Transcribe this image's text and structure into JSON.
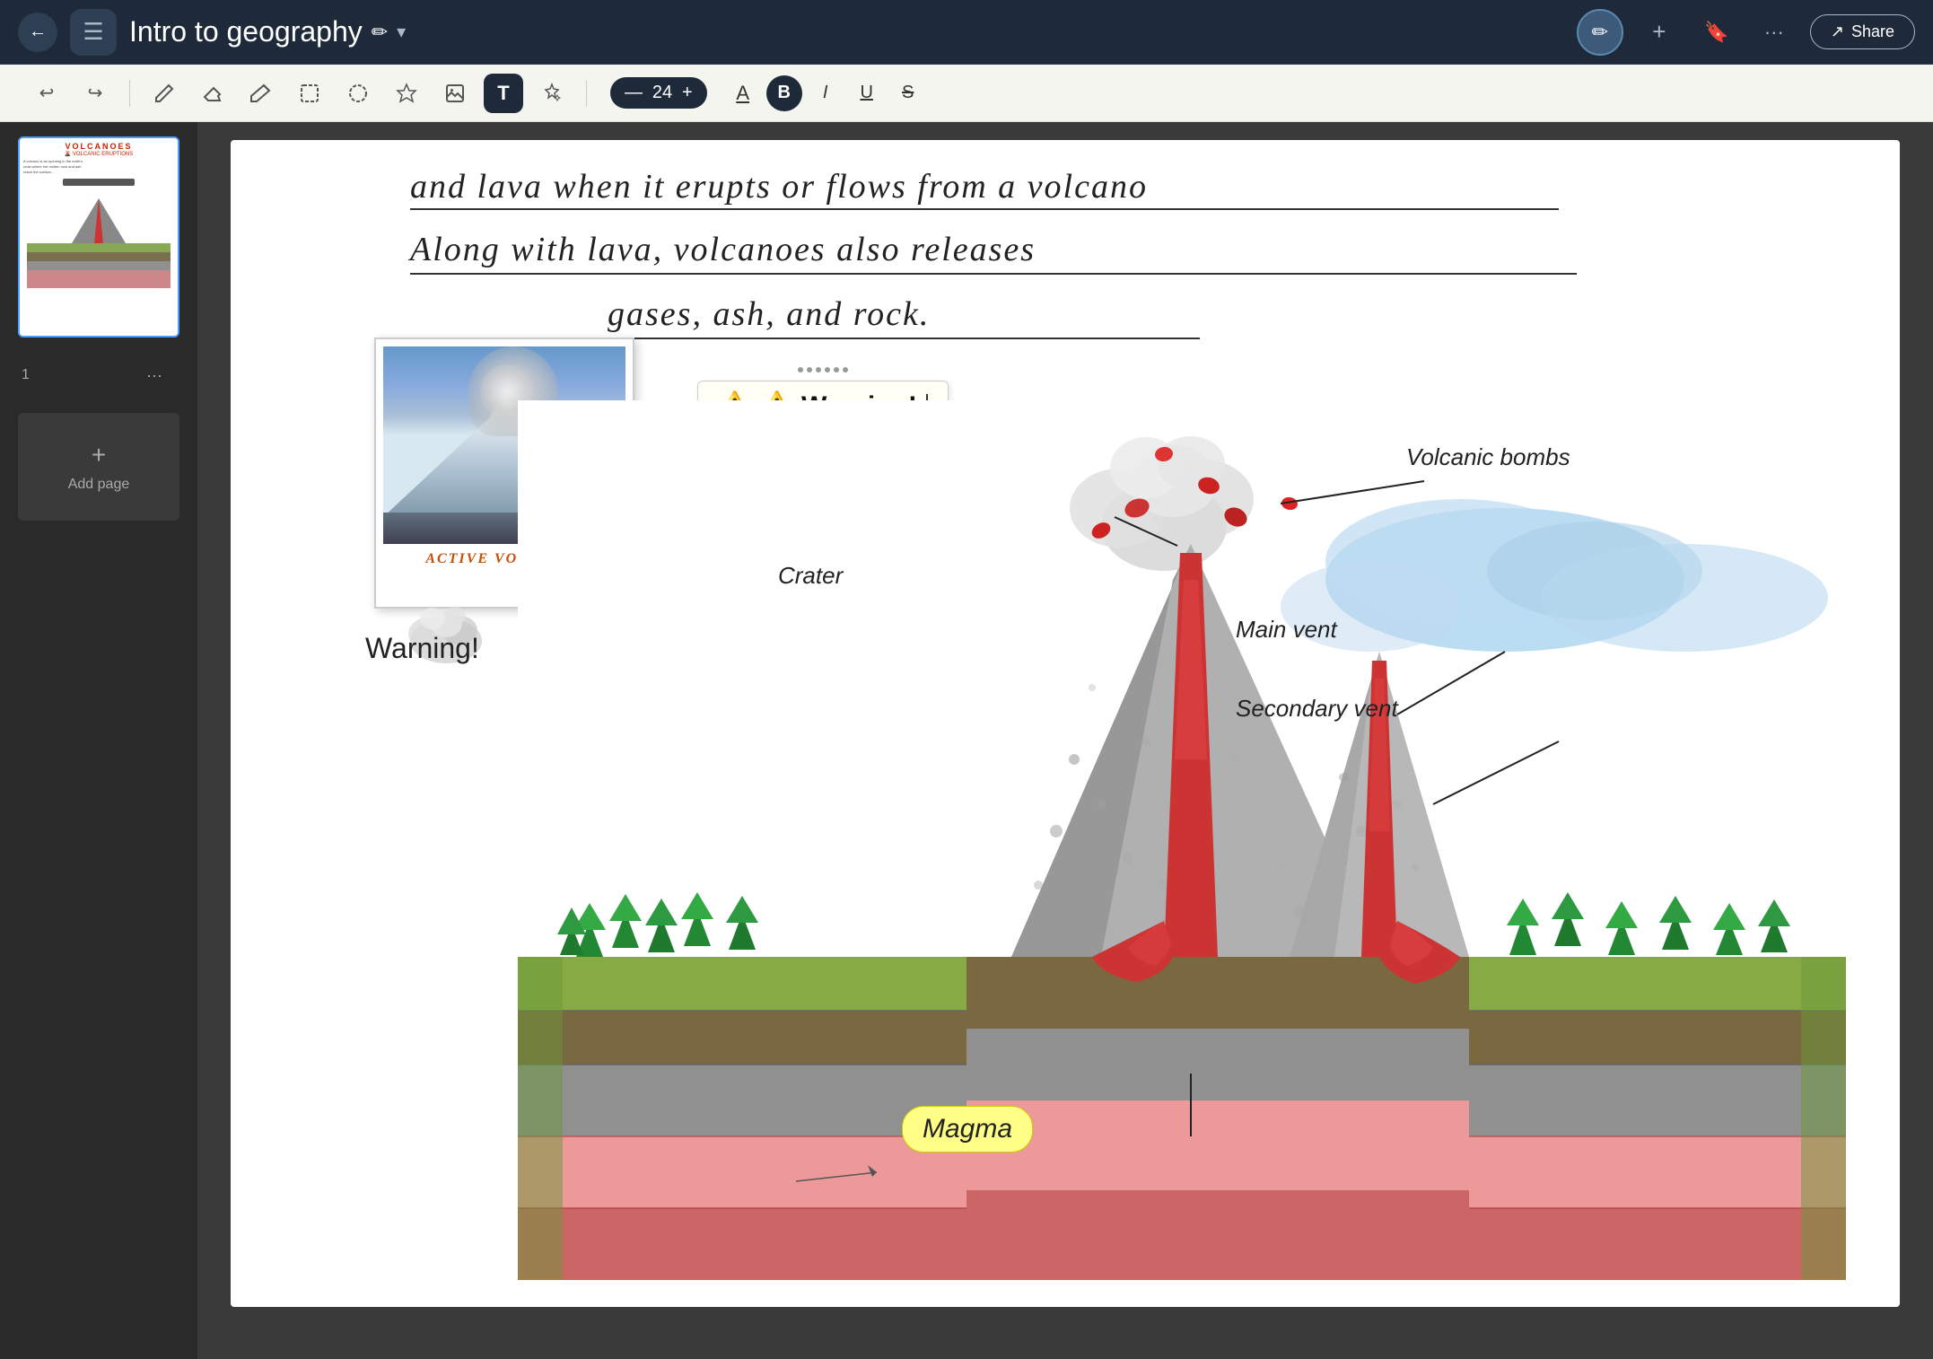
{
  "header": {
    "back_label": "←",
    "notebook_icon": "☰",
    "title": "Intro to geography",
    "title_pencil": "✏",
    "title_chevron": "▾",
    "avatar_icon": "✏",
    "add_icon": "+",
    "bookmark_icon": "🔖",
    "more_icon": "···",
    "share_icon": "↗",
    "share_label": "Share"
  },
  "toolbar": {
    "undo_label": "↩",
    "redo_label": "↪",
    "pen_label": "✒",
    "eraser_label": "◻",
    "pencil_label": "✏",
    "select_label": "⊡",
    "lasso_label": "⊙",
    "star_label": "☆",
    "image_label": "⊞",
    "text_label": "T",
    "magic_label": "✦",
    "font_size": "24",
    "font_minus": "—",
    "font_plus": "+",
    "font_color_label": "A",
    "bold_label": "B",
    "italic_label": "I",
    "underline_label": "U",
    "strikethrough_label": "S"
  },
  "sidebar": {
    "page_number": "1",
    "more_icon": "···",
    "add_page_plus": "+",
    "add_page_label": "Add page"
  },
  "canvas": {
    "line1": "and lava  when it erupts or flows from a volcano",
    "line2": "Along with  lava,  volcanoes  also  releases",
    "line3": "gases,  ash,  and  rock.",
    "warning_text": "⚠️  Warning!",
    "warning_label": "Warning!",
    "photo_caption": "ACTIVE VOLCANO!",
    "labels": {
      "volcanic_bombs": "Volcanic bombs",
      "crater": "Crater",
      "main_vent": "Main vent",
      "secondary_vent": "Secondary vent",
      "magma": "Magma"
    }
  }
}
